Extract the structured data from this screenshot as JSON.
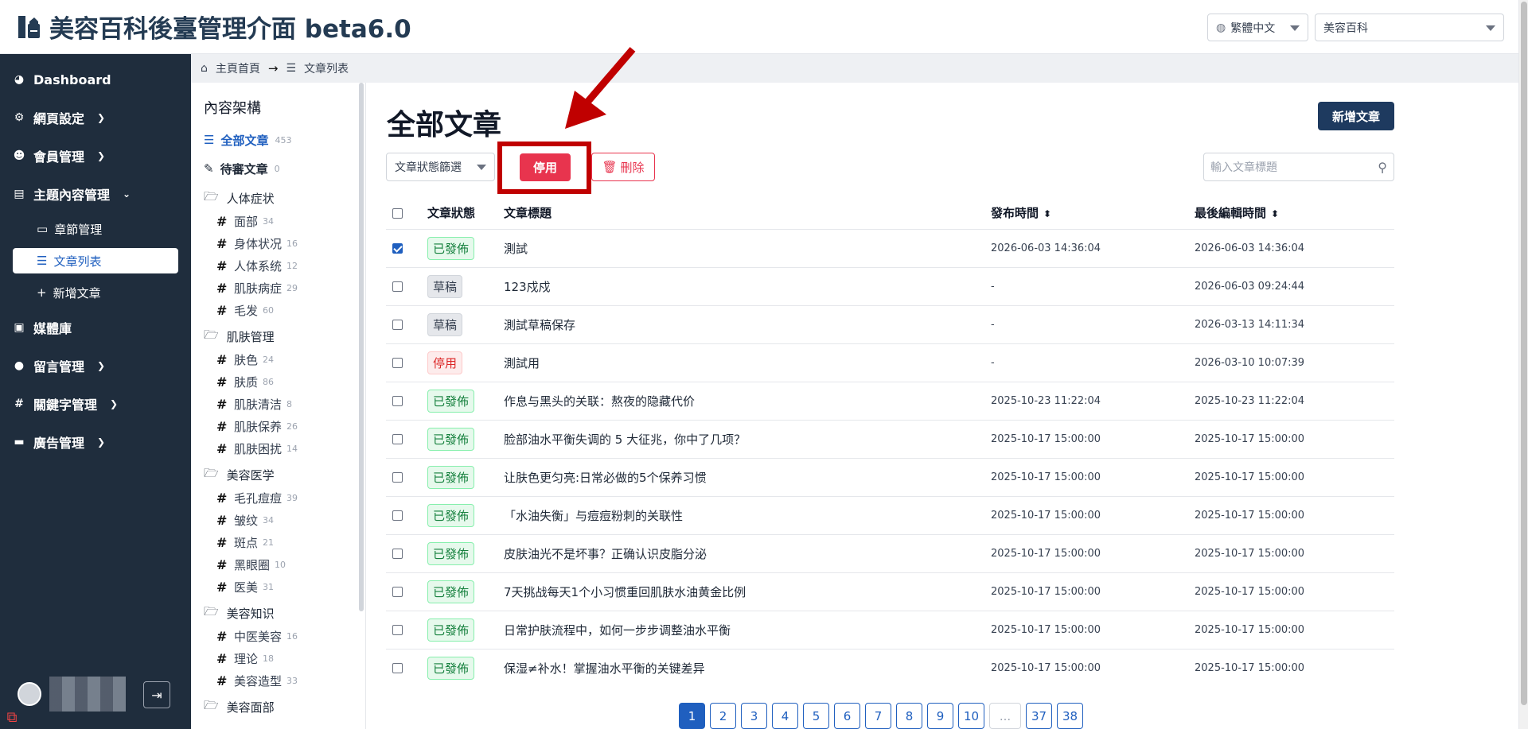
{
  "header": {
    "title": "美容百科後臺管理介面 beta6.0",
    "language_select": "繁體中文",
    "site_select": "美容百科"
  },
  "sidebar": {
    "items": [
      {
        "label": "Dashboard",
        "icon": "dashboard-icon"
      },
      {
        "label": "網頁設定",
        "icon": "gear-icon"
      },
      {
        "label": "會員管理",
        "icon": "users-icon"
      },
      {
        "label": "主題內容管理",
        "icon": "content-icon"
      },
      {
        "label": "媒體庫",
        "icon": "images-icon"
      },
      {
        "label": "留言管理",
        "icon": "comment-icon"
      },
      {
        "label": "關鍵字管理",
        "icon": "hash-icon"
      },
      {
        "label": "廣告管理",
        "icon": "ad-icon"
      }
    ],
    "sub_items": [
      {
        "label": "章節管理"
      },
      {
        "label": "文章列表"
      },
      {
        "label": "新增文章"
      }
    ]
  },
  "breadcrumb": {
    "home": "主頁首頁",
    "current": "文章列表"
  },
  "categories": {
    "title": "內容架構",
    "all": {
      "label": "全部文章",
      "count": "453"
    },
    "pending": {
      "label": "待審文章",
      "count": "0"
    },
    "groups": [
      {
        "label": "人体症状",
        "children": [
          {
            "label": "面部",
            "count": "34"
          },
          {
            "label": "身体状况",
            "count": "16"
          },
          {
            "label": "人体系统",
            "count": "12"
          },
          {
            "label": "肌肤病症",
            "count": "29"
          },
          {
            "label": "毛发",
            "count": "60"
          }
        ]
      },
      {
        "label": "肌肤管理",
        "children": [
          {
            "label": "肤色",
            "count": "24"
          },
          {
            "label": "肤质",
            "count": "86"
          },
          {
            "label": "肌肤清洁",
            "count": "8"
          },
          {
            "label": "肌肤保养",
            "count": "26"
          },
          {
            "label": "肌肤困扰",
            "count": "14"
          }
        ]
      },
      {
        "label": "美容医学",
        "children": [
          {
            "label": "毛孔痘痘",
            "count": "39"
          },
          {
            "label": "皱纹",
            "count": "34"
          },
          {
            "label": "斑点",
            "count": "21"
          },
          {
            "label": "黑眼圈",
            "count": "10"
          },
          {
            "label": "医美",
            "count": "31"
          }
        ]
      },
      {
        "label": "美容知识",
        "children": [
          {
            "label": "中医美容",
            "count": "16"
          },
          {
            "label": "理论",
            "count": "18"
          },
          {
            "label": "美容造型",
            "count": "33"
          }
        ]
      },
      {
        "label": "美容面部",
        "children": []
      }
    ]
  },
  "main": {
    "title": "全部文章",
    "add_button": "新增文章",
    "status_filter": "文章狀態篩選",
    "disable_button": "停用",
    "delete_button": "刪除",
    "search_placeholder": "輸入文章標題",
    "columns": [
      "文章狀態",
      "文章標題",
      "發布時間",
      "最後編輯時間"
    ],
    "rows": [
      {
        "checked": true,
        "status": "已發佈",
        "kind": "pub",
        "title": "測試",
        "published": "2026-06-03 14:36:04",
        "edited": "2026-06-03 14:36:04"
      },
      {
        "checked": false,
        "status": "草稿",
        "kind": "draft",
        "title": "123戍戍",
        "published": "-",
        "edited": "2026-06-03 09:24:44"
      },
      {
        "checked": false,
        "status": "草稿",
        "kind": "draft",
        "title": "測試草稿保存",
        "published": "-",
        "edited": "2026-03-13 14:11:34"
      },
      {
        "checked": false,
        "status": "停用",
        "kind": "stop",
        "title": "測試用",
        "published": "-",
        "edited": "2026-03-10 10:07:39"
      },
      {
        "checked": false,
        "status": "已發佈",
        "kind": "pub",
        "title": "作息与黑头的关联：熬夜的隐藏代价",
        "published": "2025-10-23 11:22:04",
        "edited": "2025-10-23 11:22:04"
      },
      {
        "checked": false,
        "status": "已發佈",
        "kind": "pub",
        "title": "脸部油水平衡失调的 5 大征兆，你中了几项？",
        "published": "2025-10-17 15:00:00",
        "edited": "2025-10-17 15:00:00"
      },
      {
        "checked": false,
        "status": "已發佈",
        "kind": "pub",
        "title": "让肤色更匀亮:日常必做的5个保养习惯",
        "published": "2025-10-17 15:00:00",
        "edited": "2025-10-17 15:00:00"
      },
      {
        "checked": false,
        "status": "已發佈",
        "kind": "pub",
        "title": "「水油失衡」与痘痘粉刺的关联性",
        "published": "2025-10-17 15:00:00",
        "edited": "2025-10-17 15:00:00"
      },
      {
        "checked": false,
        "status": "已發佈",
        "kind": "pub",
        "title": "皮肤油光不是坏事？正确认识皮脂分泌",
        "published": "2025-10-17 15:00:00",
        "edited": "2025-10-17 15:00:00"
      },
      {
        "checked": false,
        "status": "已發佈",
        "kind": "pub",
        "title": "7天挑战每天1个小习惯重回肌肤水油黄金比例",
        "published": "2025-10-17 15:00:00",
        "edited": "2025-10-17 15:00:00"
      },
      {
        "checked": false,
        "status": "已發佈",
        "kind": "pub",
        "title": "日常护肤流程中，如何一步步调整油水平衡",
        "published": "2025-10-17 15:00:00",
        "edited": "2025-10-17 15:00:00"
      },
      {
        "checked": false,
        "status": "已發佈",
        "kind": "pub",
        "title": "保湿≠补水！掌握油水平衡的关键差异",
        "published": "2025-10-17 15:00:00",
        "edited": "2025-10-17 15:00:00"
      }
    ],
    "pagination": [
      "1",
      "2",
      "3",
      "4",
      "5",
      "6",
      "7",
      "8",
      "9",
      "10",
      "...",
      "37",
      "38"
    ],
    "current_page": "1"
  },
  "colors": {
    "sidebar_bg": "#1f2d3d",
    "primary": "#1f5fbf",
    "danger": "#e8344e",
    "highlight": "#c00000"
  }
}
